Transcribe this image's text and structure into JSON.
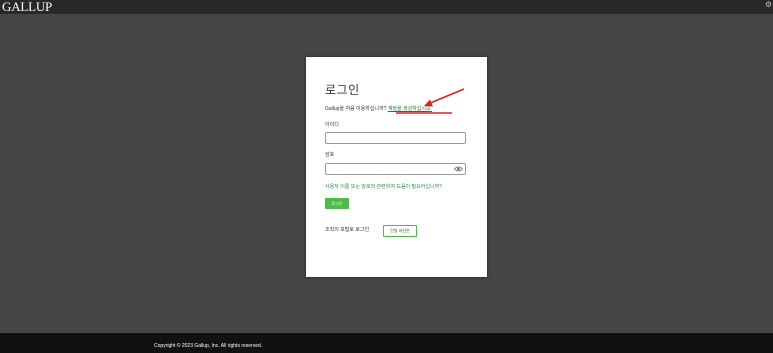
{
  "header": {
    "logo": "GALLUP",
    "settings_icon": "gear-icon"
  },
  "login": {
    "title": "로그인",
    "new_user_prompt": "Gallup을 처음 이용하십니까?",
    "create_account_link": "계정을 생성하십시오.",
    "username_label": "아이디",
    "username_value": "",
    "password_label": "암호",
    "password_value": "",
    "show_password_icon": "eye-icon",
    "help_link": "사용자 이름 또는 암호와 관련하여 도움이 필요하십니까?",
    "login_button": "로그인",
    "org_portal_label": "조직의 포털로 로그인",
    "sso_button": "단일 사인온"
  },
  "annotation": {
    "arrow_color": "#e02020",
    "arrow_icon": "red-arrow-icon"
  },
  "footer": {
    "copyright": "Copyright © 2023 Gallup, Inc. All rights reserved."
  },
  "colors": {
    "background": "#454545",
    "top_bar": "#282828",
    "footer": "#111111",
    "accent_green": "#4cbb47",
    "link_green": "#2e8b48"
  }
}
